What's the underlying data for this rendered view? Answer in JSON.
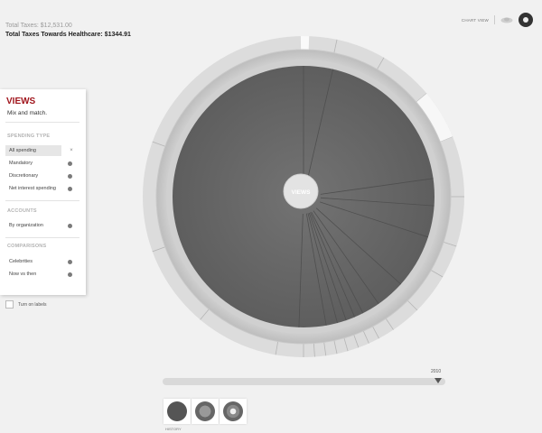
{
  "totals": {
    "total_taxes": "Total Taxes: $12,531.00",
    "healthcare": "Total Taxes Towards Healthcare: $1344.91"
  },
  "toolbar": {
    "chart_view_label": "CHART VIEW"
  },
  "panel": {
    "title": "VIEWS",
    "subtitle": "Mix and match.",
    "spending_type": {
      "title": "SPENDING TYPE",
      "options": [
        "All spending",
        "Mandatory",
        "Discretionary",
        "Net interest spending"
      ]
    },
    "accounts": {
      "title": "ACCOUNTS",
      "options": [
        "By organization"
      ]
    },
    "comparisons": {
      "title": "COMPARISONS",
      "options": [
        "Celebrities",
        "Now vs then"
      ]
    },
    "clear_symbol": "×"
  },
  "labels_toggle": {
    "label": "Turn on labels",
    "checked": false
  },
  "chart": {
    "center_label": "VIEWS"
  },
  "timeline": {
    "year": "2010"
  },
  "views_bar": {
    "history_label": "HISTORY"
  },
  "colors": {
    "accent": "#a0151c",
    "pie": "#6a6a6a",
    "rings": "#d8d8d8"
  }
}
